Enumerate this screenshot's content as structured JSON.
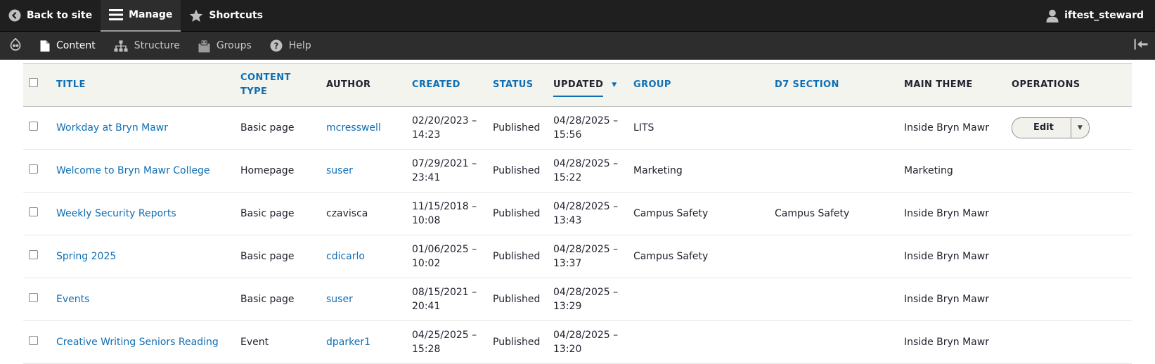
{
  "toolbar": {
    "back_label": "Back to site",
    "manage_label": "Manage",
    "shortcuts_label": "Shortcuts",
    "user_label": "iftest_steward"
  },
  "tray": {
    "items": [
      {
        "label": "Content"
      },
      {
        "label": "Structure"
      },
      {
        "label": "Groups"
      },
      {
        "label": "Help"
      }
    ]
  },
  "table": {
    "headers": {
      "title": "TITLE",
      "content_type": "CONTENT TYPE",
      "author": "AUTHOR",
      "created": "CREATED",
      "status": "STATUS",
      "updated": "UPDATED",
      "group": "GROUP",
      "d7_section": "D7 SECTION",
      "main_theme": "MAIN THEME",
      "operations": "OPERATIONS"
    },
    "rows": [
      {
        "title": "Workday at Bryn Mawr",
        "type": "Basic page",
        "author": "mcresswell",
        "created_date": "02/20/2023 –",
        "created_time": "14:23",
        "status": "Published",
        "updated_date": "04/28/2025 –",
        "updated_time": "15:56",
        "group": "LITS",
        "d7_section": "",
        "theme": "Inside Bryn Mawr",
        "op": "Edit"
      },
      {
        "title": "Welcome to Bryn Mawr College",
        "type": "Homepage",
        "author": "suser",
        "created_date": "07/29/2021 –",
        "created_time": "23:41",
        "status": "Published",
        "updated_date": "04/28/2025 –",
        "updated_time": "15:22",
        "group": "Marketing",
        "d7_section": "",
        "theme": "Marketing",
        "op": ""
      },
      {
        "title": "Weekly Security Reports",
        "type": "Basic page",
        "author": "czavisca",
        "created_date": "11/15/2018 –",
        "created_time": "10:08",
        "status": "Published",
        "updated_date": "04/28/2025 –",
        "updated_time": "13:43",
        "group": "Campus Safety",
        "d7_section": "Campus Safety",
        "theme": "Inside Bryn Mawr",
        "op": ""
      },
      {
        "title": "Spring 2025",
        "type": "Basic page",
        "author": "cdicarlo",
        "created_date": "01/06/2025 –",
        "created_time": "10:02",
        "status": "Published",
        "updated_date": "04/28/2025 –",
        "updated_time": "13:37",
        "group": "Campus Safety",
        "d7_section": "",
        "theme": "Inside Bryn Mawr",
        "op": ""
      },
      {
        "title": "Events",
        "type": "Basic page",
        "author": "suser",
        "created_date": "08/15/2021 –",
        "created_time": "20:41",
        "status": "Published",
        "updated_date": "04/28/2025 –",
        "updated_time": "13:29",
        "group": "",
        "d7_section": "",
        "theme": "Inside Bryn Mawr",
        "op": ""
      },
      {
        "title": "Creative Writing Seniors Reading",
        "type": "Event",
        "author": "dparker1",
        "created_date": "04/25/2025 –",
        "created_time": "15:28",
        "status": "Published",
        "updated_date": "04/28/2025 –",
        "updated_time": "13:20",
        "group": "",
        "d7_section": "",
        "theme": "Inside Bryn Mawr",
        "op": ""
      }
    ]
  },
  "colors": {
    "link": "#0f6fb5",
    "toolbar_bg": "#1f1f1f",
    "tray_bg": "#2d2d2d",
    "header_bg": "#f3f4ee"
  }
}
